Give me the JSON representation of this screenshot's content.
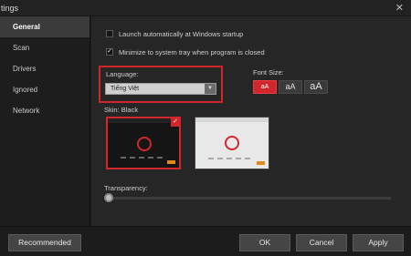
{
  "window": {
    "title": "tings"
  },
  "sidebar": {
    "items": [
      {
        "label": "General"
      },
      {
        "label": "Scan"
      },
      {
        "label": "Drivers"
      },
      {
        "label": "Ignored"
      },
      {
        "label": "Network"
      }
    ]
  },
  "options": {
    "launch_startup": {
      "label": "Launch automatically at Windows startup",
      "checked": false
    },
    "minimize_tray": {
      "label": "Minimize to system tray when program is closed",
      "checked": true
    }
  },
  "language": {
    "label": "Language:",
    "value": "Tiếng Việt"
  },
  "font_size": {
    "label": "Font Size:",
    "options": [
      "aA",
      "aA",
      "aA"
    ],
    "selected_index": 0
  },
  "skin": {
    "label": "Skin: Black",
    "options": [
      "Black",
      "White"
    ],
    "selected": "Black"
  },
  "transparency": {
    "label": "Transparency:",
    "value_fraction": 0.0
  },
  "footer": {
    "recommended": "Recommended",
    "ok": "OK",
    "cancel": "Cancel",
    "apply": "Apply"
  },
  "colors": {
    "accent": "#d1262c",
    "highlight_border": "#d0262a"
  }
}
